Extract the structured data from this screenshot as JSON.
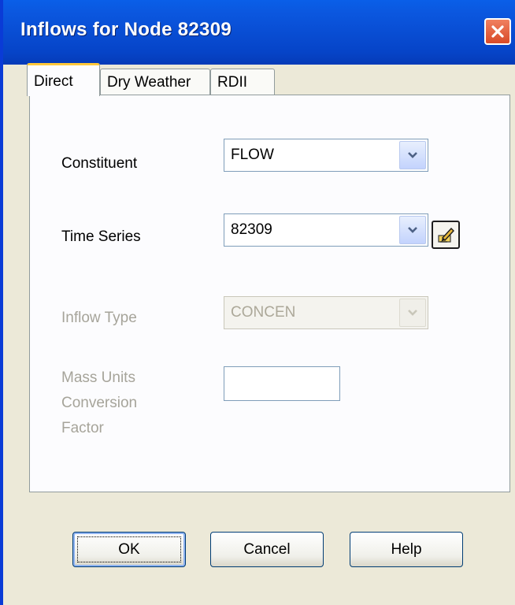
{
  "window": {
    "title": "Inflows for Node 82309"
  },
  "tabs": [
    {
      "label": "Direct",
      "active": true
    },
    {
      "label": "Dry Weather",
      "active": false
    },
    {
      "label": "RDII",
      "active": false
    }
  ],
  "form": {
    "constituent_label": "Constituent",
    "constituent_value": "FLOW",
    "time_series_label": "Time Series",
    "time_series_value": "82309",
    "inflow_type_label": "Inflow Type",
    "inflow_type_value": "CONCEN",
    "mass_units_label_line1": "Mass Units",
    "mass_units_label_line2": "Conversion",
    "mass_units_label_line3": "Factor",
    "mass_units_value": ""
  },
  "buttons": {
    "ok": "OK",
    "cancel": "Cancel",
    "help": "Help"
  },
  "icons": {
    "close": "close-icon",
    "dropdown": "chevron-down-icon",
    "edit": "pencil-edit-icon"
  },
  "colors": {
    "titlebar": "#0b57df",
    "close_button": "#d84a28",
    "active_tab_accent": "#ffc83c",
    "dialog_background": "#ece9d8",
    "disabled_text": "#a6a49a"
  }
}
